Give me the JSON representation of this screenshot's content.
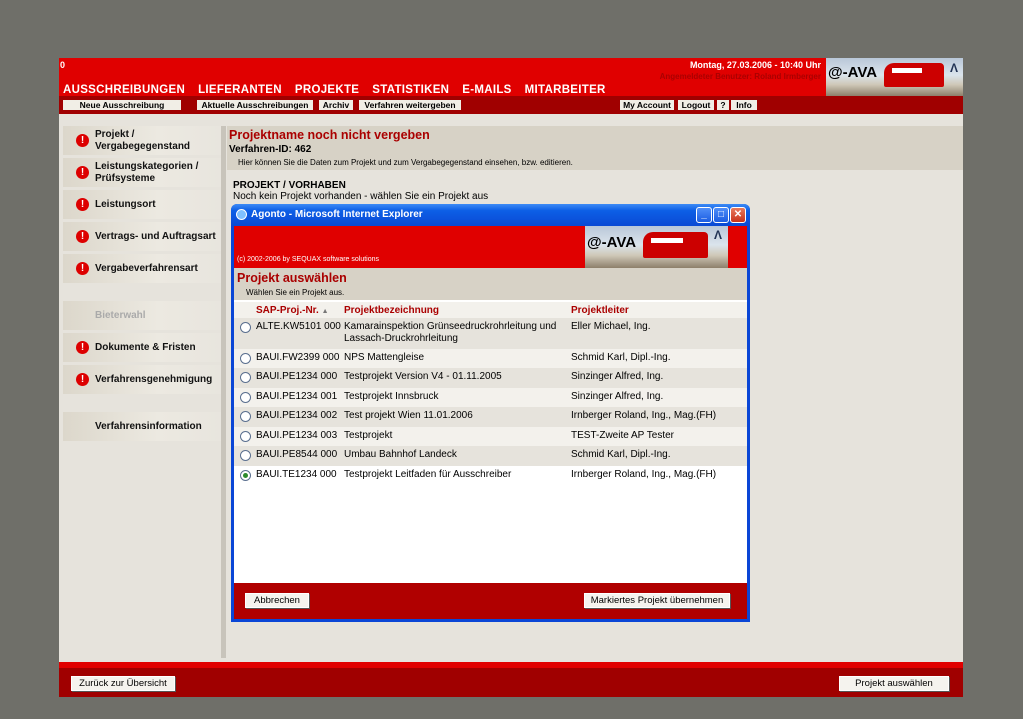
{
  "header": {
    "corner_label": "0",
    "date_time": "Montag, 27.03.2006 - 10:40 Uhr",
    "user_line": "Angemeldeter Benutzer: Roland Irmberger",
    "logo_text": "@-AVA",
    "main_nav": [
      "AUSSCHREIBUNGEN",
      "LIEFERANTEN",
      "PROJEKTE",
      "STATISTIKEN",
      "E-MAILS",
      "MITARBEITER"
    ],
    "sub_nav_left": [
      "Neue Ausschreibung",
      "Aktuelle Ausschreibungen",
      "Archiv",
      "Verfahren weitergeben"
    ],
    "sub_nav_right": [
      "My Account",
      "Logout",
      "?",
      "Info"
    ]
  },
  "sidebar": {
    "items": [
      {
        "label": "Projekt / Vergabegegenstand",
        "alert": true
      },
      {
        "label": "Leistungskategorien / Prüfsysteme",
        "alert": true
      },
      {
        "label": "Leistungsort",
        "alert": true
      },
      {
        "label": "Vertrags- und Auftragsart",
        "alert": true
      },
      {
        "label": "Vergabeverfahrensart",
        "alert": true
      },
      {
        "label": "Bieterwahl",
        "alert": false,
        "disabled": true
      },
      {
        "label": "Dokumente & Fristen",
        "alert": true
      },
      {
        "label": "Verfahrensgenehmigung",
        "alert": true
      },
      {
        "label": "Verfahrensinformation",
        "alert": false
      }
    ]
  },
  "content": {
    "title": "Projektname noch nicht vergeben",
    "procedure_id": "Verfahren-ID: 462",
    "hint": "Hier können Sie die Daten zum Projekt und zum Vergabegegenstand einsehen, bzw. editieren.",
    "section_heading": "PROJEKT / VORHABEN",
    "section_text": "Noch kein Projekt vorhanden - wählen Sie ein Projekt aus"
  },
  "popup": {
    "window_title": "Agonto - Microsoft Internet Explorer",
    "copyright": "(c) 2002-2006 by SEQUAX software solutions",
    "logo_text": "@-AVA",
    "heading": "Projekt auswählen",
    "subheading": "Wählen Sie ein Projekt aus.",
    "columns": [
      "SAP-Proj.-Nr. ",
      "Projektbezeichnung",
      "Projektleiter"
    ],
    "sort_indicator": "▲",
    "rows": [
      {
        "nr": "ALTE.KW5101 000",
        "name": "Kamarainspektion Grünseedruckrohrleitung und Lassach-Druckrohrleitung",
        "leader": "Eller Michael, Ing.",
        "selected": false
      },
      {
        "nr": "BAUI.FW2399 000",
        "name": "NPS Mattengleise",
        "leader": "Schmid Karl, Dipl.-Ing.",
        "selected": false
      },
      {
        "nr": "BAUI.PE1234 000",
        "name": "Testprojekt Version V4 - 01.11.2005",
        "leader": "Sinzinger Alfred, Ing.",
        "selected": false
      },
      {
        "nr": "BAUI.PE1234 001",
        "name": "Testprojekt Innsbruck",
        "leader": "Sinzinger Alfred, Ing.",
        "selected": false
      },
      {
        "nr": "BAUI.PE1234 002",
        "name": "Test projekt Wien 11.01.2006",
        "leader": "Irnberger Roland, Ing., Mag.(FH)",
        "selected": false
      },
      {
        "nr": "BAUI.PE1234 003",
        "name": "Testprojekt",
        "leader": "TEST-Zweite AP Tester",
        "selected": false
      },
      {
        "nr": "BAUI.PE8544 000",
        "name": "Umbau Bahnhof Landeck",
        "leader": "Schmid Karl, Dipl.-Ing.",
        "selected": false
      },
      {
        "nr": "BAUI.TE1234 000",
        "name": "Testprojekt Leitfaden für Ausschreiber",
        "leader": "Irnberger Roland, Ing., Mag.(FH)",
        "selected": true
      }
    ],
    "cancel_label": "Abbrechen",
    "accept_label": "Markiertes Projekt übernehmen"
  },
  "footer": {
    "back_label": "Zurück zur Übersicht",
    "select_label": "Projekt auswählen"
  },
  "colors": {
    "brand_red": "#e00000",
    "dark_red": "#a00000",
    "xp_blue": "#0a46d6",
    "background": "#6f6f69"
  }
}
